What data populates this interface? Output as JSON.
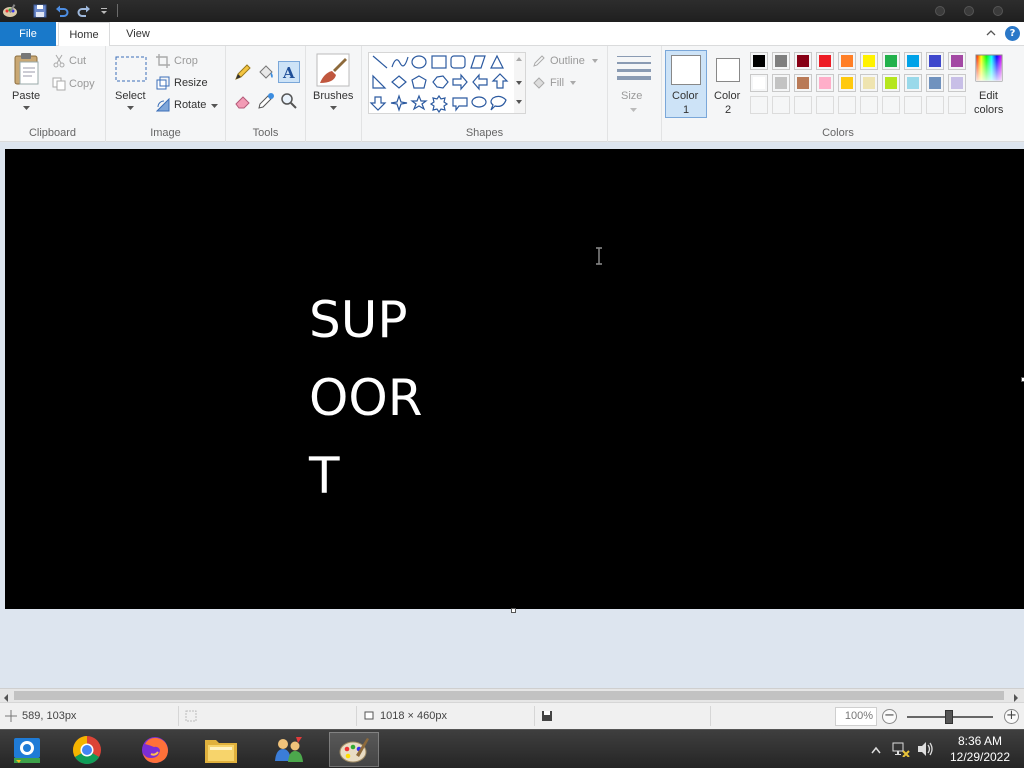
{
  "ribbon": {
    "tabs": {
      "file": "File",
      "home": "Home",
      "view": "View"
    },
    "help": "?",
    "clipboard": {
      "paste": "Paste",
      "cut": "Cut",
      "copy": "Copy",
      "label": "Clipboard"
    },
    "image": {
      "select": "Select",
      "crop": "Crop",
      "resize": "Resize",
      "rotate": "Rotate",
      "label": "Image"
    },
    "tools": {
      "label": "Tools"
    },
    "brushes": {
      "label": "Brushes"
    },
    "shapes": {
      "outline": "Outline",
      "fill": "Fill",
      "label": "Shapes"
    },
    "size": {
      "label": "Size"
    },
    "colors": {
      "color1_label": "Color",
      "color1_num": "1",
      "color2_label": "Color",
      "color2_num": "2",
      "edit_label": "Edit",
      "edit_label2": "colors",
      "label": "Colors",
      "color1_value": "#ffffff",
      "color2_value": "#ffffff",
      "palette_row1": [
        "#000000",
        "#7f7f7f",
        "#880015",
        "#ed1c24",
        "#ff7f27",
        "#fff200",
        "#22b14c",
        "#00a2e8",
        "#3f48cc",
        "#a349a4"
      ],
      "palette_row2": [
        "#ffffff",
        "#c3c3c3",
        "#b97a57",
        "#ffaec9",
        "#ffc90e",
        "#efe4b0",
        "#b5e61d",
        "#99d9ea",
        "#7092be",
        "#c8bfe7"
      ]
    }
  },
  "canvas": {
    "background": "#000000",
    "text_color": "#ffffff",
    "text": "SUP\nOOR\nT"
  },
  "status": {
    "cursor_pos": "589, 103px",
    "canvas_size": "1018 × 460px",
    "zoom": "100%",
    "zoom_out": "−",
    "zoom_in": "+"
  },
  "taskbar": {
    "time": "8:36 AM",
    "date": "12/29/2022",
    "apps": [
      "chrome-remote-desktop",
      "chrome",
      "firefox",
      "file-explorer",
      "network-people",
      "paint"
    ]
  }
}
